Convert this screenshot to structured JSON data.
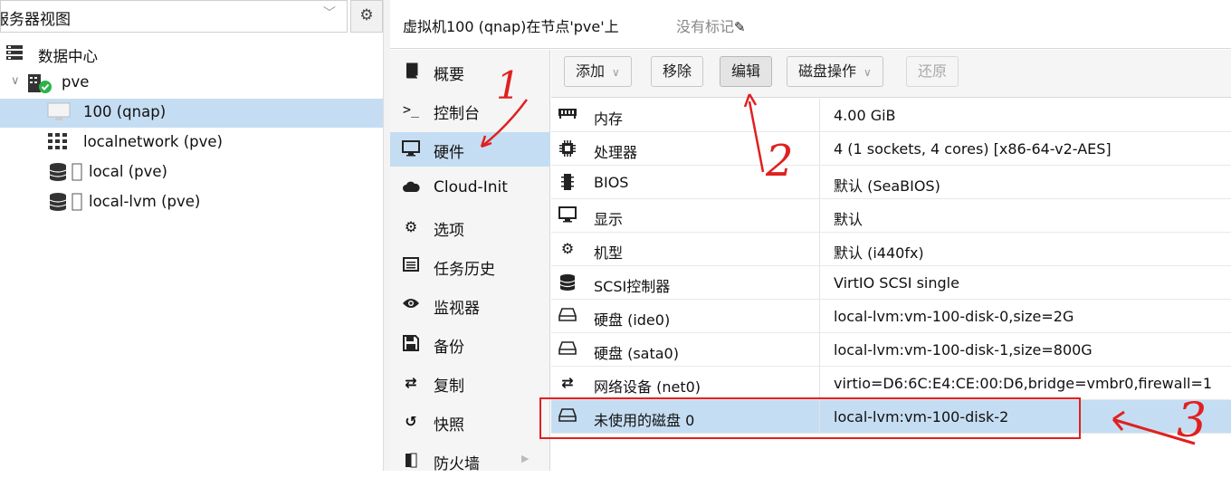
{
  "left": {
    "view_selector": "服务器视图",
    "tree": [
      {
        "label": "数据中心",
        "icon": "server-rack-icon"
      },
      {
        "label": "pve",
        "icon": "node-icon"
      },
      {
        "label": "100 (qnap)",
        "icon": "vm-monitor-icon"
      },
      {
        "label": "localnetwork (pve)",
        "icon": "network-grid-icon"
      },
      {
        "label": "local (pve)",
        "icon": "storage-icon"
      },
      {
        "label": "local-lvm (pve)",
        "icon": "storage-icon"
      }
    ]
  },
  "header": {
    "title": "虚拟机100 (qnap)在节点'pve'上",
    "tags": "没有标记"
  },
  "nav": {
    "items": [
      {
        "label": "概要",
        "icon": "book-icon"
      },
      {
        "label": "控制台",
        "icon": "terminal-icon"
      },
      {
        "label": "硬件",
        "icon": "desktop-icon"
      },
      {
        "label": "Cloud-Init",
        "icon": "cloud-icon"
      },
      {
        "label": "选项",
        "icon": "gear-icon"
      },
      {
        "label": "任务历史",
        "icon": "list-icon"
      },
      {
        "label": "监视器",
        "icon": "eye-icon"
      },
      {
        "label": "备份",
        "icon": "floppy-icon"
      },
      {
        "label": "复制",
        "icon": "retweet-icon"
      },
      {
        "label": "快照",
        "icon": "history-icon"
      },
      {
        "label": "防火墙",
        "icon": "shield-icon"
      }
    ]
  },
  "toolbar": {
    "add": "添加",
    "remove": "移除",
    "edit": "编辑",
    "disk_action": "磁盘操作",
    "revert": "还原"
  },
  "hardware": {
    "rows": [
      {
        "key": "内存",
        "value": "4.00 GiB",
        "icon": "memory-icon"
      },
      {
        "key": "处理器",
        "value": "4 (1 sockets, 4 cores) [x86-64-v2-AES]",
        "icon": "cpu-icon"
      },
      {
        "key": "BIOS",
        "value": "默认 (SeaBIOS)",
        "icon": "microchip-icon"
      },
      {
        "key": "显示",
        "value": "默认",
        "icon": "desktop-icon"
      },
      {
        "key": "机型",
        "value": "默认 (i440fx)",
        "icon": "cogs-icon"
      },
      {
        "key": "SCSI控制器",
        "value": "VirtIO SCSI single",
        "icon": "database-icon"
      },
      {
        "key": "硬盘 (ide0)",
        "value": "local-lvm:vm-100-disk-0,size=2G",
        "icon": "hdd-icon"
      },
      {
        "key": "硬盘 (sata0)",
        "value": "local-lvm:vm-100-disk-1,size=800G",
        "icon": "hdd-icon"
      },
      {
        "key": "网络设备 (net0)",
        "value": "virtio=D6:6C:E4:CE:00:D6,bridge=vmbr0,firewall=1",
        "icon": "exchange-icon"
      },
      {
        "key": "未使用的磁盘 0",
        "value": "local-lvm:vm-100-disk-2",
        "icon": "hdd-icon"
      }
    ]
  },
  "annotations": {
    "n1": "1",
    "n2": "2",
    "n3": "3",
    "color": "#e02020"
  }
}
